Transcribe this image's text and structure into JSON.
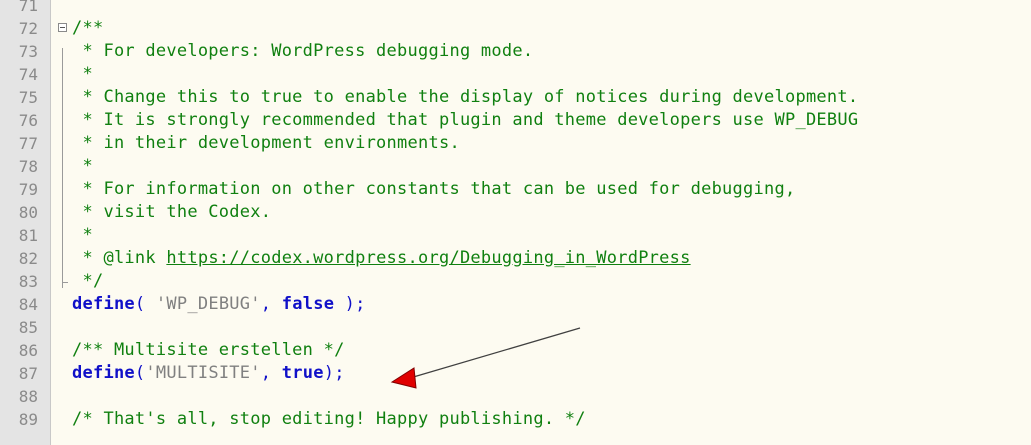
{
  "lines": [
    {
      "num": "71",
      "segments": [
        {
          "cls": "str",
          "text": ""
        }
      ]
    },
    {
      "num": "72",
      "segments": [
        {
          "cls": "comment",
          "text": "/**"
        }
      ]
    },
    {
      "num": "73",
      "segments": [
        {
          "cls": "comment",
          "text": " * For developers: WordPress debugging mode."
        }
      ]
    },
    {
      "num": "74",
      "segments": [
        {
          "cls": "comment",
          "text": " *"
        }
      ]
    },
    {
      "num": "75",
      "segments": [
        {
          "cls": "comment",
          "text": " * Change this to true to enable the display of notices during development."
        }
      ]
    },
    {
      "num": "76",
      "segments": [
        {
          "cls": "comment",
          "text": " * It is strongly recommended that plugin and theme developers use WP_DEBUG"
        }
      ]
    },
    {
      "num": "77",
      "segments": [
        {
          "cls": "comment",
          "text": " * in their development environments."
        }
      ]
    },
    {
      "num": "78",
      "segments": [
        {
          "cls": "comment",
          "text": " *"
        }
      ]
    },
    {
      "num": "79",
      "segments": [
        {
          "cls": "comment",
          "text": " * For information on other constants that can be used for debugging,"
        }
      ]
    },
    {
      "num": "80",
      "segments": [
        {
          "cls": "comment",
          "text": " * visit the Codex."
        }
      ]
    },
    {
      "num": "81",
      "segments": [
        {
          "cls": "comment",
          "text": " *"
        }
      ]
    },
    {
      "num": "82",
      "segments": [
        {
          "cls": "comment",
          "text": " * @link "
        },
        {
          "cls": "link",
          "text": "https://codex.wordpress.org/Debugging_in_WordPress"
        }
      ]
    },
    {
      "num": "83",
      "segments": [
        {
          "cls": "comment",
          "text": " */"
        }
      ]
    },
    {
      "num": "84",
      "segments": [
        {
          "cls": "fn",
          "text": "define"
        },
        {
          "cls": "punct",
          "text": "( "
        },
        {
          "cls": "str",
          "text": "'WP_DEBUG'"
        },
        {
          "cls": "punct",
          "text": ", "
        },
        {
          "cls": "kw",
          "text": "false"
        },
        {
          "cls": "punct",
          "text": " );"
        }
      ]
    },
    {
      "num": "85",
      "segments": []
    },
    {
      "num": "86",
      "segments": [
        {
          "cls": "comment",
          "text": "/** Multisite erstellen */"
        }
      ]
    },
    {
      "num": "87",
      "segments": [
        {
          "cls": "fn",
          "text": "define"
        },
        {
          "cls": "punct",
          "text": "("
        },
        {
          "cls": "str",
          "text": "'MULTISITE'"
        },
        {
          "cls": "punct",
          "text": ", "
        },
        {
          "cls": "kw",
          "text": "true"
        },
        {
          "cls": "punct",
          "text": ");"
        }
      ]
    },
    {
      "num": "88",
      "segments": []
    },
    {
      "num": "89",
      "segments": [
        {
          "cls": "comment",
          "text": "/* That's all, stop editing! Happy publishing. */"
        }
      ]
    }
  ],
  "colors": {
    "comment": "#108010",
    "keyword": "#1010c8",
    "string": "#808080",
    "gutter": "#e4e4e4",
    "background": "#fdfbf1",
    "arrow": "#e00000"
  },
  "icons": {
    "fold": "fold-collapse-icon",
    "fold_end": "fold-end-icon",
    "annotation": "red-arrow-icon"
  }
}
